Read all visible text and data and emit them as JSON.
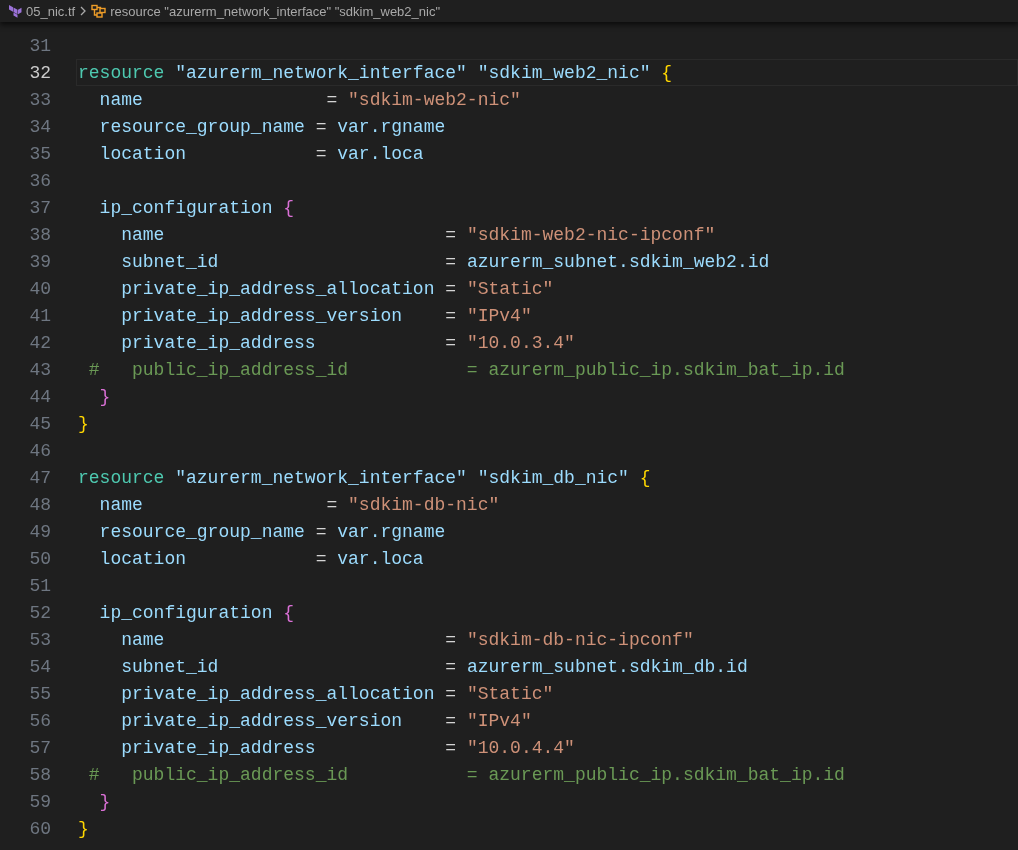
{
  "breadcrumb": {
    "file": "05_nic.tf",
    "symbol": "resource \"azurerm_network_interface\" \"sdkim_web2_nic\""
  },
  "editor": {
    "lines": [
      {
        "number": "31",
        "active": false
      },
      {
        "number": "32",
        "active": true,
        "tokens": [
          {
            "kind": "keyword",
            "text": "resource "
          },
          {
            "kind": "label",
            "text": "\"azurerm_network_interface\" \"sdkim_web2_nic\" "
          },
          {
            "kind": "brace1",
            "text": "{"
          }
        ]
      },
      {
        "number": "33",
        "active": false,
        "tokens": [
          {
            "kind": "attr",
            "text": "  name                "
          },
          {
            "kind": "op",
            "text": " = "
          },
          {
            "kind": "string",
            "text": "\"sdkim-web2-nic\""
          }
        ]
      },
      {
        "number": "34",
        "active": false,
        "tokens": [
          {
            "kind": "attr",
            "text": "  resource_group_name"
          },
          {
            "kind": "op",
            "text": " = "
          },
          {
            "kind": "attr",
            "text": "var.rgname"
          }
        ]
      },
      {
        "number": "35",
        "active": false,
        "tokens": [
          {
            "kind": "attr",
            "text": "  location           "
          },
          {
            "kind": "op",
            "text": " = "
          },
          {
            "kind": "attr",
            "text": "var.loca"
          }
        ]
      },
      {
        "number": "36",
        "active": false
      },
      {
        "number": "37",
        "active": false,
        "tokens": [
          {
            "kind": "attr",
            "text": "  ip_configuration "
          },
          {
            "kind": "brace2",
            "text": "{"
          }
        ]
      },
      {
        "number": "38",
        "active": false,
        "tokens": [
          {
            "kind": "attr",
            "text": "    name                         "
          },
          {
            "kind": "op",
            "text": " = "
          },
          {
            "kind": "string",
            "text": "\"sdkim-web2-nic-ipconf\""
          }
        ]
      },
      {
        "number": "39",
        "active": false,
        "tokens": [
          {
            "kind": "attr",
            "text": "    subnet_id                    "
          },
          {
            "kind": "op",
            "text": " = "
          },
          {
            "kind": "attr",
            "text": "azurerm_subnet.sdkim_web2.id"
          }
        ]
      },
      {
        "number": "40",
        "active": false,
        "tokens": [
          {
            "kind": "attr",
            "text": "    private_ip_address_allocation"
          },
          {
            "kind": "op",
            "text": " = "
          },
          {
            "kind": "string",
            "text": "\"Static\""
          }
        ]
      },
      {
        "number": "41",
        "active": false,
        "tokens": [
          {
            "kind": "attr",
            "text": "    private_ip_address_version   "
          },
          {
            "kind": "op",
            "text": " = "
          },
          {
            "kind": "string",
            "text": "\"IPv4\""
          }
        ]
      },
      {
        "number": "42",
        "active": false,
        "tokens": [
          {
            "kind": "attr",
            "text": "    private_ip_address           "
          },
          {
            "kind": "op",
            "text": " = "
          },
          {
            "kind": "string",
            "text": "\"10.0.3.4\""
          }
        ]
      },
      {
        "number": "43",
        "active": false,
        "tokens": [
          {
            "kind": "comment",
            "text": " #   public_ip_address_id           = azurerm_public_ip.sdkim_bat_ip.id"
          }
        ]
      },
      {
        "number": "44",
        "active": false,
        "tokens": [
          {
            "kind": "brace2",
            "text": "  }"
          }
        ]
      },
      {
        "number": "45",
        "active": false,
        "tokens": [
          {
            "kind": "brace1",
            "text": "}"
          }
        ]
      },
      {
        "number": "46",
        "active": false
      },
      {
        "number": "47",
        "active": false,
        "tokens": [
          {
            "kind": "keyword",
            "text": "resource "
          },
          {
            "kind": "label",
            "text": "\"azurerm_network_interface\" \"sdkim_db_nic\" "
          },
          {
            "kind": "brace1",
            "text": "{"
          }
        ]
      },
      {
        "number": "48",
        "active": false,
        "tokens": [
          {
            "kind": "attr",
            "text": "  name                "
          },
          {
            "kind": "op",
            "text": " = "
          },
          {
            "kind": "string",
            "text": "\"sdkim-db-nic\""
          }
        ]
      },
      {
        "number": "49",
        "active": false,
        "tokens": [
          {
            "kind": "attr",
            "text": "  resource_group_name"
          },
          {
            "kind": "op",
            "text": " = "
          },
          {
            "kind": "attr",
            "text": "var.rgname"
          }
        ]
      },
      {
        "number": "50",
        "active": false,
        "tokens": [
          {
            "kind": "attr",
            "text": "  location           "
          },
          {
            "kind": "op",
            "text": " = "
          },
          {
            "kind": "attr",
            "text": "var.loca"
          }
        ]
      },
      {
        "number": "51",
        "active": false
      },
      {
        "number": "52",
        "active": false,
        "tokens": [
          {
            "kind": "attr",
            "text": "  ip_configuration "
          },
          {
            "kind": "brace2",
            "text": "{"
          }
        ]
      },
      {
        "number": "53",
        "active": false,
        "tokens": [
          {
            "kind": "attr",
            "text": "    name                         "
          },
          {
            "kind": "op",
            "text": " = "
          },
          {
            "kind": "string",
            "text": "\"sdkim-db-nic-ipconf\""
          }
        ]
      },
      {
        "number": "54",
        "active": false,
        "tokens": [
          {
            "kind": "attr",
            "text": "    subnet_id                    "
          },
          {
            "kind": "op",
            "text": " = "
          },
          {
            "kind": "attr",
            "text": "azurerm_subnet.sdkim_db.id"
          }
        ]
      },
      {
        "number": "55",
        "active": false,
        "tokens": [
          {
            "kind": "attr",
            "text": "    private_ip_address_allocation"
          },
          {
            "kind": "op",
            "text": " = "
          },
          {
            "kind": "string",
            "text": "\"Static\""
          }
        ]
      },
      {
        "number": "56",
        "active": false,
        "tokens": [
          {
            "kind": "attr",
            "text": "    private_ip_address_version   "
          },
          {
            "kind": "op",
            "text": " = "
          },
          {
            "kind": "string",
            "text": "\"IPv4\""
          }
        ]
      },
      {
        "number": "57",
        "active": false,
        "tokens": [
          {
            "kind": "attr",
            "text": "    private_ip_address           "
          },
          {
            "kind": "op",
            "text": " = "
          },
          {
            "kind": "string",
            "text": "\"10.0.4.4\""
          }
        ]
      },
      {
        "number": "58",
        "active": false,
        "tokens": [
          {
            "kind": "comment",
            "text": " #   public_ip_address_id           = azurerm_public_ip.sdkim_bat_ip.id"
          }
        ]
      },
      {
        "number": "59",
        "active": false,
        "tokens": [
          {
            "kind": "brace2",
            "text": "  }"
          }
        ]
      },
      {
        "number": "60",
        "active": false,
        "tokens": [
          {
            "kind": "brace1",
            "text": "}"
          }
        ]
      }
    ]
  }
}
